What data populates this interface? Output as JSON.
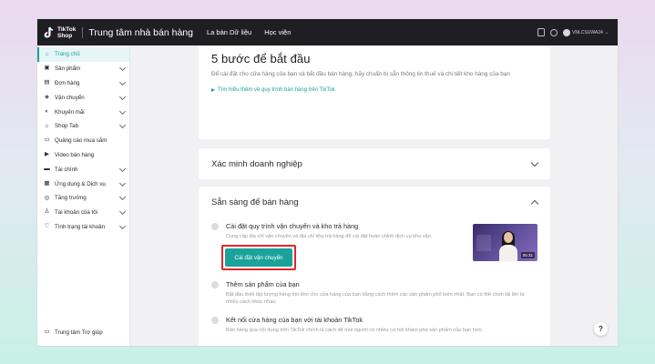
{
  "topbar": {
    "logo_line1": "TikTok",
    "logo_line2": "Shop",
    "title": "Trung tâm nhà bán hàng",
    "nav": [
      "La bàn Dữ liệu",
      "Học viện"
    ],
    "user_name": "VNLCSUWA24"
  },
  "sidebar": {
    "items": [
      {
        "label": "Trang chủ",
        "icon": "home-icon",
        "glyph": "⌂",
        "expandable": false,
        "active": true
      },
      {
        "label": "Sản phẩm",
        "icon": "product-icon",
        "glyph": "▣",
        "expandable": true,
        "active": false
      },
      {
        "label": "Đơn hàng",
        "icon": "order-icon",
        "glyph": "▤",
        "expandable": true,
        "active": false
      },
      {
        "label": "Vận chuyển",
        "icon": "shipping-icon",
        "glyph": "◈",
        "expandable": true,
        "active": false
      },
      {
        "label": "Khuyến mãi",
        "icon": "promotion-icon",
        "glyph": "◐",
        "expandable": true,
        "active": false
      },
      {
        "label": "Shop Tab",
        "icon": "shop-icon",
        "glyph": "⌂",
        "expandable": true,
        "active": false
      },
      {
        "label": "Quảng cáo mua sắm",
        "icon": "ads-icon",
        "glyph": "▭",
        "expandable": false,
        "active": false
      },
      {
        "label": "Video bán hàng",
        "icon": "video-icon",
        "glyph": "▶",
        "expandable": false,
        "active": false
      },
      {
        "label": "Tài chính",
        "icon": "finance-icon",
        "glyph": "▬",
        "expandable": true,
        "active": false
      },
      {
        "label": "Ứng dụng & Dịch vụ",
        "icon": "apps-icon",
        "glyph": "▦",
        "expandable": true,
        "active": false
      },
      {
        "label": "Tăng trưởng",
        "icon": "growth-icon",
        "glyph": "◎",
        "expandable": true,
        "active": false
      },
      {
        "label": "Tài khoản của tôi",
        "icon": "account-icon",
        "glyph": "♙",
        "expandable": true,
        "active": false
      },
      {
        "label": "Tình trạng tài khoản",
        "icon": "account-health-icon",
        "glyph": "♡",
        "expandable": true,
        "active": false
      }
    ],
    "help_label": "Trung tâm Trợ giúp"
  },
  "main": {
    "start_card": {
      "title": "5 bước để bắt đầu",
      "description": "Để cài đặt cho cửa hàng của bạn và bắt đầu bán hàng, hãy chuẩn bị sẵn thông tin thuế và chi tiết kho hàng của bạn",
      "link": "Tìm hiểu thêm về quy trình bán hàng trên TikTok"
    },
    "verify_section": {
      "title": "Xác minh doanh nghiệp"
    },
    "ready_section": {
      "title": "Sẵn sàng để bán hàng",
      "steps": [
        {
          "title": "Cài đặt quy trình vận chuyển và kho trả hàng",
          "description": "Cung cấp địa chỉ vận chuyển và địa chỉ kho trả hàng để cài đặt hoàn chỉnh dịch vụ kho vận.",
          "button": "Cài đặt vận chuyển"
        },
        {
          "title": "Thêm sản phẩm của bạn",
          "description": "Bắt đầu thiết lập lượng hàng tồn kho cho cửa hàng của bạn bằng cách thêm các sản phẩm phổ biến nhất. Bạn có thể chọn tải lên từ nhiều cách khác nhau."
        },
        {
          "title": "Kết nối cửa hàng của bạn với tài khoản TikTok",
          "description": "Bán hàng qua nội dung trên TikTok chính là cách để mọi người có nhiều cơ hội khám phá sản phẩm của bạn hơn."
        }
      ],
      "video_duration": "05:31"
    },
    "help_fab": "?"
  },
  "colors": {
    "accent": "#1aa39a",
    "highlight_border": "#e3242b",
    "topbar": "#1f1f23"
  }
}
